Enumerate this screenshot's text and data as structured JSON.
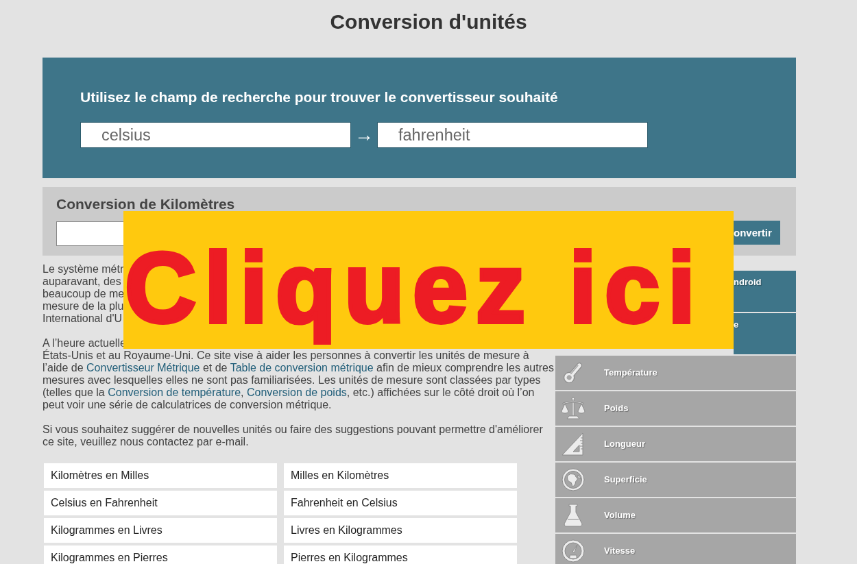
{
  "page_title": "Conversion d'unités",
  "search_panel": {
    "heading": "Utilisez le champ de recherche pour trouver le convertisseur souhaité",
    "from_field": {
      "placeholder": "celsius"
    },
    "arrow": "→",
    "to_field": {
      "placeholder": "fahrenheit"
    }
  },
  "converter_panel": {
    "heading": "Conversion de Kilomètres",
    "button": "onvertir"
  },
  "intro_visible_lines": [
    "Le système métr",
    "auparavant, des",
    "beaucoup de me",
    "mesure de la plu",
    "International d'U"
  ],
  "description": {
    "visible_first_line": "A l’heure actuelle",
    "parts": [
      {
        "kind": "text",
        "text": "États-Unis et au Royaume-Uni. Ce site vise à aider les personnes à convertir les unités de mesure à l’aide de "
      },
      {
        "kind": "link",
        "text": "Convertisseur Métrique"
      },
      {
        "kind": "text",
        "text": " et de "
      },
      {
        "kind": "link",
        "text": "Table de conversion métrique"
      },
      {
        "kind": "text",
        "text": " afin de mieux comprendre les autres mesures avec lesquelles elles ne sont pas familiarisées. Les unités de mesure sont classées par types (telles que la "
      },
      {
        "kind": "link",
        "text": "Conversion de température"
      },
      {
        "kind": "text",
        "text": ", "
      },
      {
        "kind": "link",
        "text": "Conversion de poids"
      },
      {
        "kind": "text",
        "text": ", etc.) affichées sur le côté droit où l’on peut voir une série de calculatrices de conversion métrique."
      }
    ]
  },
  "contact_text": "Si vous souhaitez suggérer de nouvelles unités ou faire des suggestions pouvant permettre d'améliorer ce site, veuillez nous contactez par e-mail.",
  "quick_links": [
    "Kilomètres en Milles",
    "Milles en Kilomètres",
    "Celsius en Fahrenheit",
    "Fahrenheit en Celsius",
    "Kilogrammes en Livres",
    "Livres en Kilogrammes",
    "Kilogrammes en Pierres",
    "Pierres en Kilogrammes"
  ],
  "sidebar": {
    "items": [
      {
        "kind": "promo",
        "label": "ndroid"
      },
      {
        "kind": "promo",
        "label": "e"
      },
      {
        "kind": "category",
        "label": "Température"
      },
      {
        "kind": "category",
        "label": "Poids"
      },
      {
        "kind": "category",
        "label": "Longueur"
      },
      {
        "kind": "category",
        "label": "Superficie"
      },
      {
        "kind": "category",
        "label": "Volume"
      },
      {
        "kind": "category",
        "label": "Vitesse"
      }
    ]
  },
  "overlay_banner": {
    "text": "Cliquez ici"
  }
}
